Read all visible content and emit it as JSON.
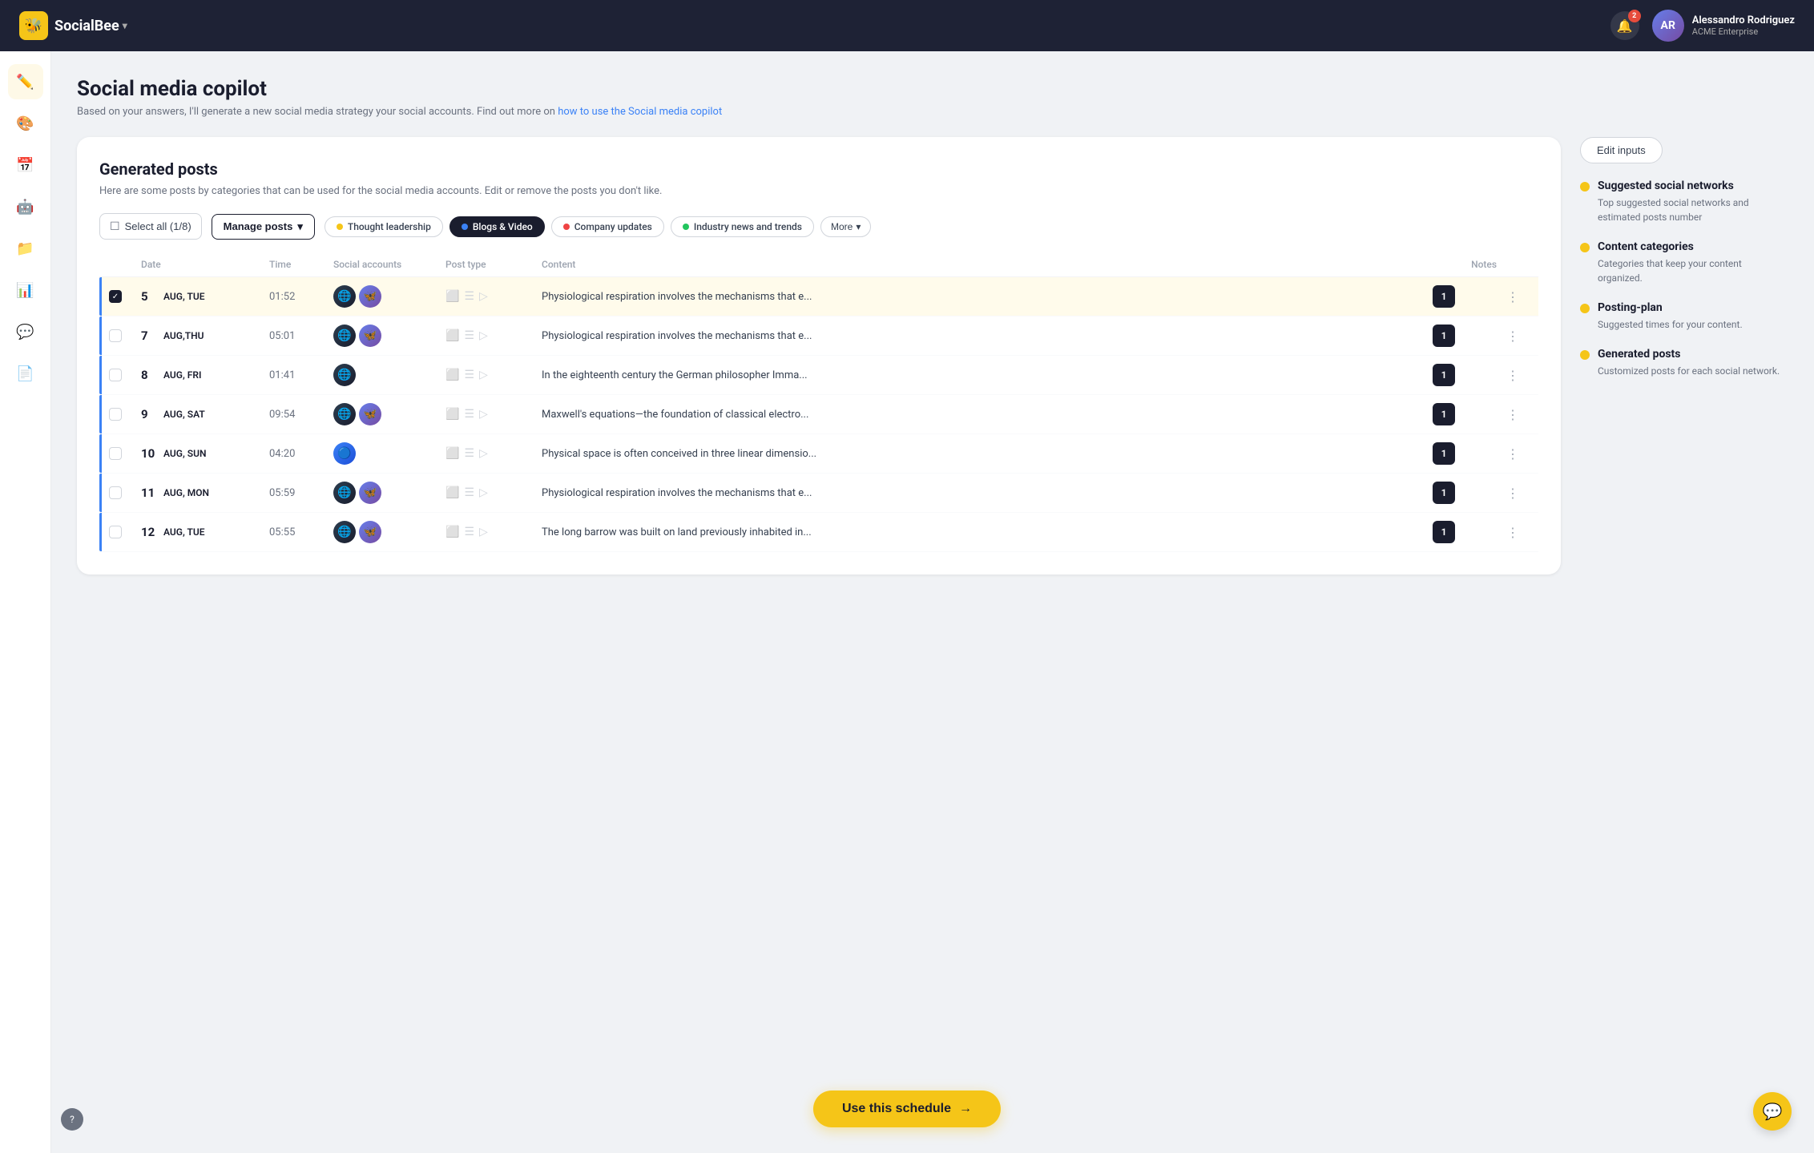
{
  "app": {
    "name": "SocialBee",
    "chevron": "▾"
  },
  "nav": {
    "notification_count": "2",
    "user_name": "Alessandro Rodriguez",
    "user_org": "ACME Enterprise",
    "user_initials": "AR"
  },
  "sidebar": {
    "items": [
      {
        "id": "edit",
        "icon": "✏️",
        "label": "Create post",
        "active": true
      },
      {
        "id": "palette",
        "icon": "🎨",
        "label": "Design"
      },
      {
        "id": "calendar",
        "icon": "📅",
        "label": "Calendar"
      },
      {
        "id": "robot",
        "icon": "🤖",
        "label": "AI copilot"
      },
      {
        "id": "folder",
        "icon": "📁",
        "label": "Content"
      },
      {
        "id": "chart",
        "icon": "📊",
        "label": "Analytics"
      },
      {
        "id": "chat",
        "icon": "💬",
        "label": "Engage"
      },
      {
        "id": "doc",
        "icon": "📄",
        "label": "Reports"
      }
    ],
    "bottom": [
      {
        "id": "help",
        "icon": "?",
        "label": "Help"
      }
    ]
  },
  "page": {
    "title": "Social media copilot",
    "subtitle": "Based on your answers, I'll generate a new social media strategy  your social accounts. Find out more on ",
    "link_text": "how to use the Social media copilot",
    "link_href": "#"
  },
  "main_panel": {
    "title": "Generated posts",
    "subtitle": "Here are some posts by categories that can be used for the social media accounts. Edit or remove the posts you don't like.",
    "select_all_label": "Select all (1/8)",
    "manage_posts_label": "Manage posts",
    "more_label": "More",
    "categories": [
      {
        "id": "thought",
        "label": "Thought leadership",
        "color": "#f5c518",
        "active": false
      },
      {
        "id": "blogs",
        "label": "Blogs & Video",
        "color": "#3b82f6",
        "active": true
      },
      {
        "id": "company",
        "label": "Company updates",
        "color": "#ef4444",
        "active": false
      },
      {
        "id": "industry",
        "label": "Industry news and trends",
        "color": "#22c55e",
        "active": false
      }
    ],
    "table_headers": [
      "",
      "Date",
      "Time",
      "Social accounts",
      "Post type",
      "Content",
      "Notes",
      ""
    ],
    "rows": [
      {
        "id": 1,
        "checked": true,
        "date_num": "5",
        "date_label": "AUG, TUE",
        "time": "01:52",
        "accounts": [
          "dark",
          "purple"
        ],
        "post_types": [
          "image",
          "text",
          "video"
        ],
        "content": "Physiological respiration involves the mechanisms that e...",
        "notes": "1",
        "accent": "#3b82f6"
      },
      {
        "id": 2,
        "checked": false,
        "date_num": "7",
        "date_label": "AUG,THU",
        "time": "05:01",
        "accounts": [
          "dark",
          "purple"
        ],
        "post_types": [
          "image",
          "text",
          "video"
        ],
        "content": "Physiological respiration involves the mechanisms that e...",
        "notes": "1",
        "accent": "#3b82f6"
      },
      {
        "id": 3,
        "checked": false,
        "date_num": "8",
        "date_label": "AUG, FRI",
        "time": "01:41",
        "accounts": [
          "dark"
        ],
        "post_types": [
          "image",
          "text",
          "video"
        ],
        "content": "In the eighteenth century the German philosopher Imma...",
        "notes": "1",
        "accent": "#3b82f6"
      },
      {
        "id": 4,
        "checked": false,
        "date_num": "9",
        "date_label": "AUG, SAT",
        "time": "09:54",
        "accounts": [
          "dark",
          "purple"
        ],
        "post_types": [
          "image",
          "text",
          "video"
        ],
        "content": "Maxwell's equations—the foundation of classical electro...",
        "notes": "1",
        "accent": "#3b82f6"
      },
      {
        "id": 5,
        "checked": false,
        "date_num": "10",
        "date_label": "AUG, SUN",
        "time": "04:20",
        "accounts": [
          "blue"
        ],
        "post_types": [
          "image",
          "text",
          "video"
        ],
        "content": "Physical space is often conceived in three linear dimensio...",
        "notes": "1",
        "accent": "#3b82f6"
      },
      {
        "id": 6,
        "checked": false,
        "date_num": "11",
        "date_label": "AUG, MON",
        "time": "05:59",
        "accounts": [
          "dark",
          "purple"
        ],
        "post_types": [
          "image",
          "text",
          "video"
        ],
        "content": "Physiological respiration involves the mechanisms that e...",
        "notes": "1",
        "accent": "#3b82f6"
      },
      {
        "id": 7,
        "checked": false,
        "date_num": "12",
        "date_label": "AUG, TUE",
        "time": "05:55",
        "accounts": [
          "dark",
          "purple"
        ],
        "post_types": [
          "image",
          "text",
          "video"
        ],
        "content": "The long barrow was built on land previously inhabited in...",
        "notes": "1",
        "accent": "#3b82f6"
      }
    ]
  },
  "right_panel": {
    "edit_inputs_label": "Edit inputs",
    "steps": [
      {
        "title": "Suggested social networks",
        "desc": "Top suggested social networks and estimated posts number"
      },
      {
        "title": "Content categories",
        "desc": "Categories that keep your content organized."
      },
      {
        "title": "Posting-plan",
        "desc": "Suggested times for your content."
      },
      {
        "title": "Generated posts",
        "desc": "Customized posts for each social network."
      }
    ]
  },
  "use_schedule_label": "Use this schedule",
  "chat_icon": "💬",
  "help_icon": "?"
}
